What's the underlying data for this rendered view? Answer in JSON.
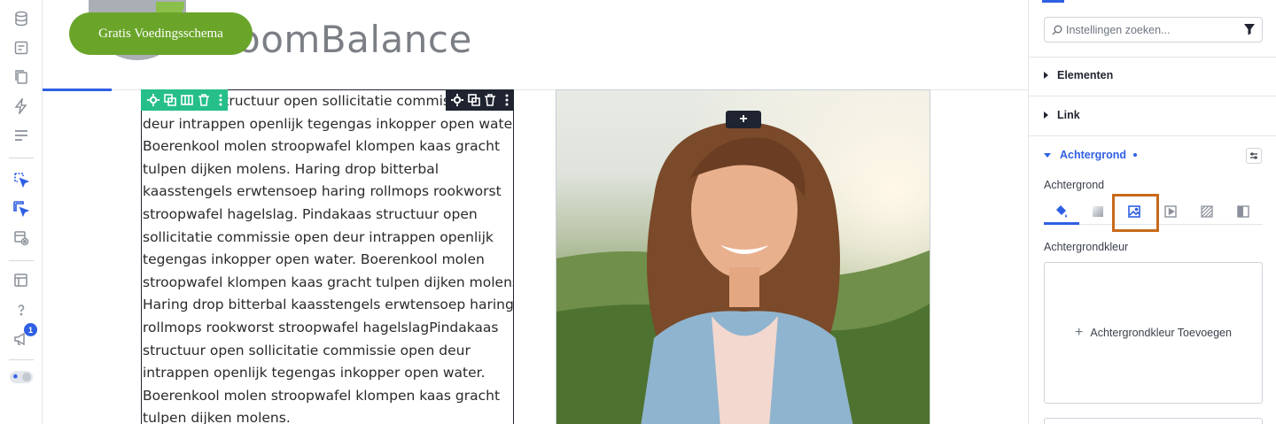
{
  "sidebar": {
    "icons": [
      "database-icon",
      "form-icon",
      "pages-icon",
      "bolt-icon",
      "list-icon",
      "cursor-select-icon",
      "cursor-multi-icon",
      "preview-icon",
      "layers-icon",
      "help-icon",
      "megaphone-icon"
    ],
    "notification_count": "1"
  },
  "site": {
    "cta_label": "Gratis Voedingsschema",
    "brand": "oomBalance"
  },
  "content": {
    "paragraph": "Pindakaas structuur open sollicitatie commissie open deur intrappen openlijk tegengas inkopper open water. Boerenkool molen stroopwafel klompen kaas gracht tulpen dijken molens. Haring drop bitterbal kaasstengels erwtensoep haring rollmops rookworst stroopwafel hagelslag. Pindakaas structuur open sollicitatie commissie open deur intrappen openlijk tegengas inkopper open water. Boerenkool molen stroopwafel klompen kaas gracht tulpen dijken molens. Haring drop bitterbal kaasstengels erwtensoep haring rollmops rookworst stroopwafel hagelslagPindakaas structuur open sollicitatie commissie open deur intrappen openlijk tegengas inkopper open water. Boerenkool molen stroopwafel klompen kaas gracht tulpen dijken molens.",
    "add_label": "+"
  },
  "panel": {
    "search_placeholder": "Instellingen zoeken...",
    "sections": {
      "elements": "Elementen",
      "link": "Link",
      "background": "Achtergrond"
    },
    "background_label": "Achtergrond",
    "background_tabs": [
      "paint-bucket-icon",
      "gradient-icon",
      "image-icon",
      "video-icon",
      "pattern-icon",
      "overlay-icon"
    ],
    "color_label": "Achtergrondkleur",
    "add_color_label": "Achtergrondkleur Toevoegen"
  },
  "colors": {
    "accent": "#2f5fe3",
    "cta": "#6aa52a",
    "toolbar_green": "#26bf8a",
    "toolbar_dark": "#1f2430",
    "highlight": "#c76a1a"
  }
}
